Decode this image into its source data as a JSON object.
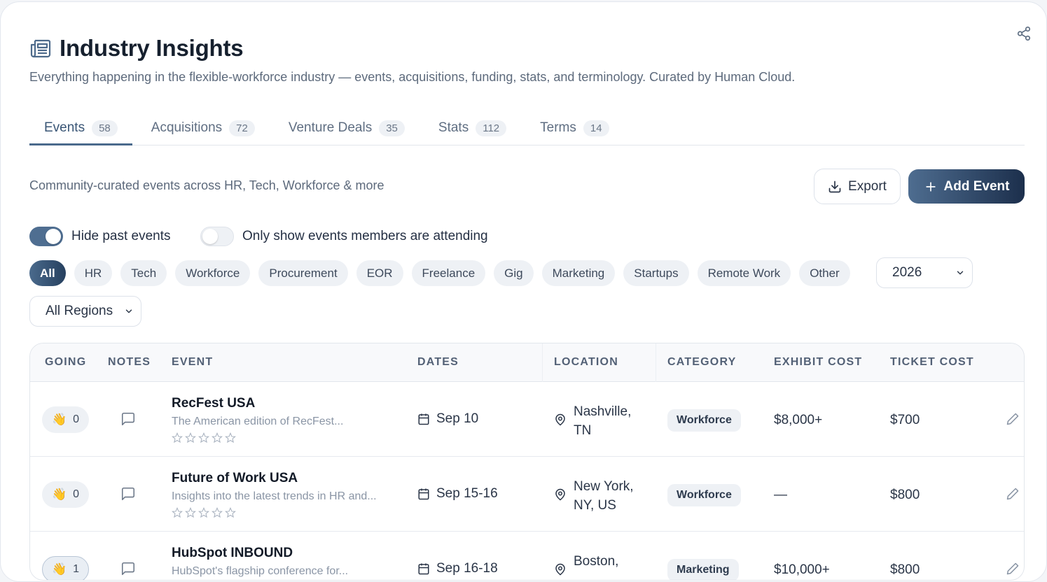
{
  "header": {
    "title": "Industry Insights",
    "subtitle": "Everything happening in the flexible-workforce industry — events, acquisitions, funding, stats, and terminology. Curated by Human Cloud."
  },
  "tabs": [
    {
      "label": "Events",
      "count": "58",
      "active": true
    },
    {
      "label": "Acquisitions",
      "count": "72"
    },
    {
      "label": "Venture Deals",
      "count": "35"
    },
    {
      "label": "Stats",
      "count": "112"
    },
    {
      "label": "Terms",
      "count": "14"
    }
  ],
  "toolbar": {
    "description": "Community-curated events across HR, Tech, Workforce & more",
    "export_label": "Export",
    "add_label": "Add Event"
  },
  "toggles": {
    "hide_past": {
      "label": "Hide past events",
      "on": true
    },
    "members_attending": {
      "label": "Only show events members are attending",
      "on": false
    }
  },
  "filters": {
    "chips": [
      "All",
      "HR",
      "Tech",
      "Workforce",
      "Procurement",
      "EOR",
      "Freelance",
      "Gig",
      "Marketing",
      "Startups",
      "Remote Work",
      "Other"
    ],
    "active_chip": "All",
    "year": "2026",
    "region": "All Regions"
  },
  "table": {
    "headers": [
      "GOING",
      "NOTES",
      "EVENT",
      "DATES",
      "LOCATION",
      "CATEGORY",
      "EXHIBIT COST",
      "TICKET COST"
    ],
    "rows": [
      {
        "going": "0",
        "name": "RecFest USA",
        "desc": "The American edition of RecFest...",
        "dates": "Sep 10",
        "loc1": "Nashville,",
        "loc2": "TN",
        "category": "Workforce",
        "exhibit": "$8,000+",
        "ticket": "$700"
      },
      {
        "going": "0",
        "name": "Future of Work USA",
        "desc": "Insights into the latest trends in HR and...",
        "dates": "Sep 15-16",
        "loc1": "New York,",
        "loc2": "NY, US",
        "category": "Workforce",
        "exhibit": "—",
        "ticket": "$800"
      },
      {
        "going": "1",
        "name": "HubSpot INBOUND",
        "desc": "HubSpot's flagship conference for...",
        "dates": "Sep 16-18",
        "loc1": "Boston,",
        "loc2": "",
        "category": "Marketing",
        "exhibit": "$10,000+",
        "ticket": "$800"
      }
    ]
  },
  "colors": {
    "accent": "#4a6a8c",
    "accent_dark": "#1c2f4c",
    "chip_bg": "#eef1f5"
  },
  "icons": {
    "title": "newspaper-icon",
    "share": "share-icon",
    "export": "download-icon",
    "add": "plus-icon",
    "going": "waving-hand-icon",
    "notes": "message-square-icon",
    "date": "calendar-icon",
    "location": "map-pin-icon",
    "edit": "pencil-icon",
    "rating": "star-icon"
  }
}
